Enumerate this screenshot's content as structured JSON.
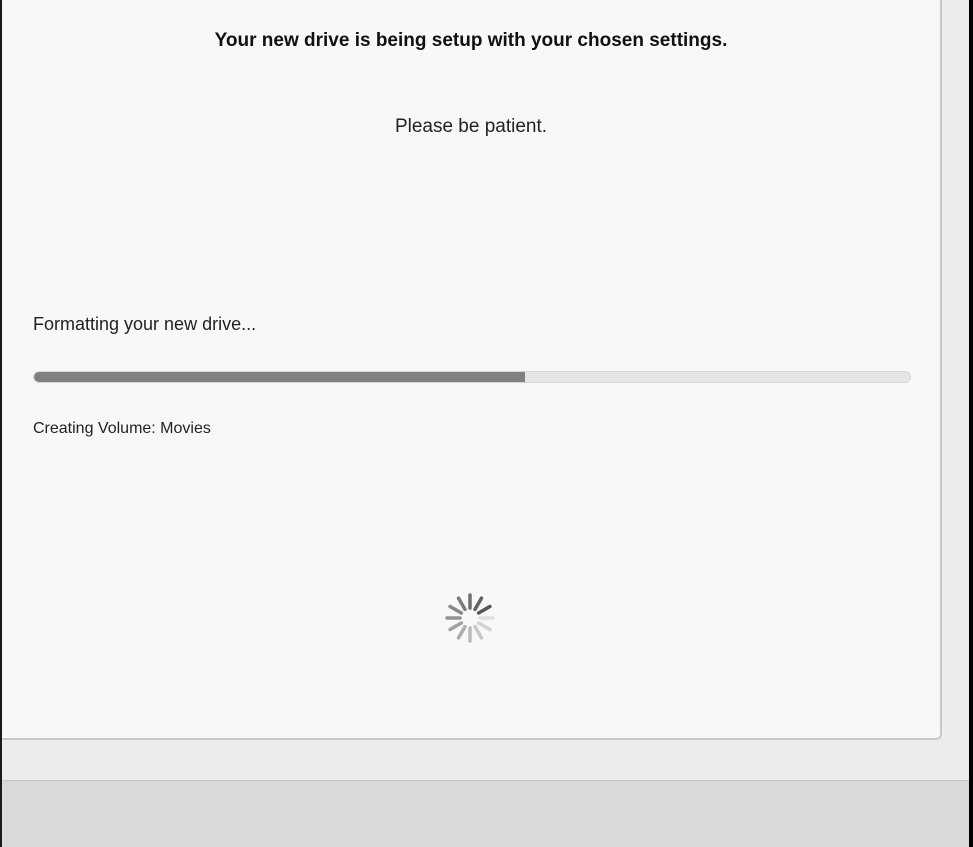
{
  "setup": {
    "heading": "Your new drive is being setup with your chosen settings.",
    "subheading": "Please be patient.",
    "status": "Formatting your new drive...",
    "progress_fraction": 0.56,
    "detail": "Creating Volume: Movies"
  },
  "spinner": {
    "icon": "loading-spinner-icon",
    "color": "#555555"
  },
  "colors": {
    "progress_fill": "#808080",
    "progress_track": "#e6e6e6",
    "panel_background": "#f8f8f8"
  }
}
